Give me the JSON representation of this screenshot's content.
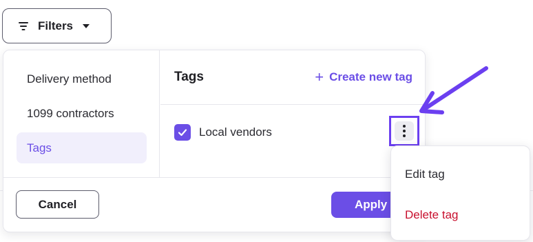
{
  "filters_button": {
    "label": "Filters"
  },
  "sidebar": {
    "items": [
      {
        "label": "Delivery method"
      },
      {
        "label": "1099 contractors"
      },
      {
        "label": "Tags",
        "selected": true
      }
    ]
  },
  "tags_panel": {
    "title": "Tags",
    "create_label": "Create new tag",
    "tags": [
      {
        "label": "Local vendors",
        "checked": true
      }
    ]
  },
  "footer": {
    "cancel_label": "Cancel",
    "apply_label": "Apply"
  },
  "context_menu": {
    "items": [
      {
        "label": "Edit tag"
      },
      {
        "label": "Delete tag",
        "destructive": true
      }
    ]
  },
  "colors": {
    "accent": "#6b4ee6",
    "danger": "#c8102e",
    "annotation": "#6b3ff0"
  },
  "icons": {
    "filter": "filter-lines-icon",
    "caret": "caret-down-icon",
    "plus": "plus-icon",
    "check": "check-icon",
    "kebab": "kebab-menu-icon",
    "arrow": "annotation-arrow-icon"
  }
}
